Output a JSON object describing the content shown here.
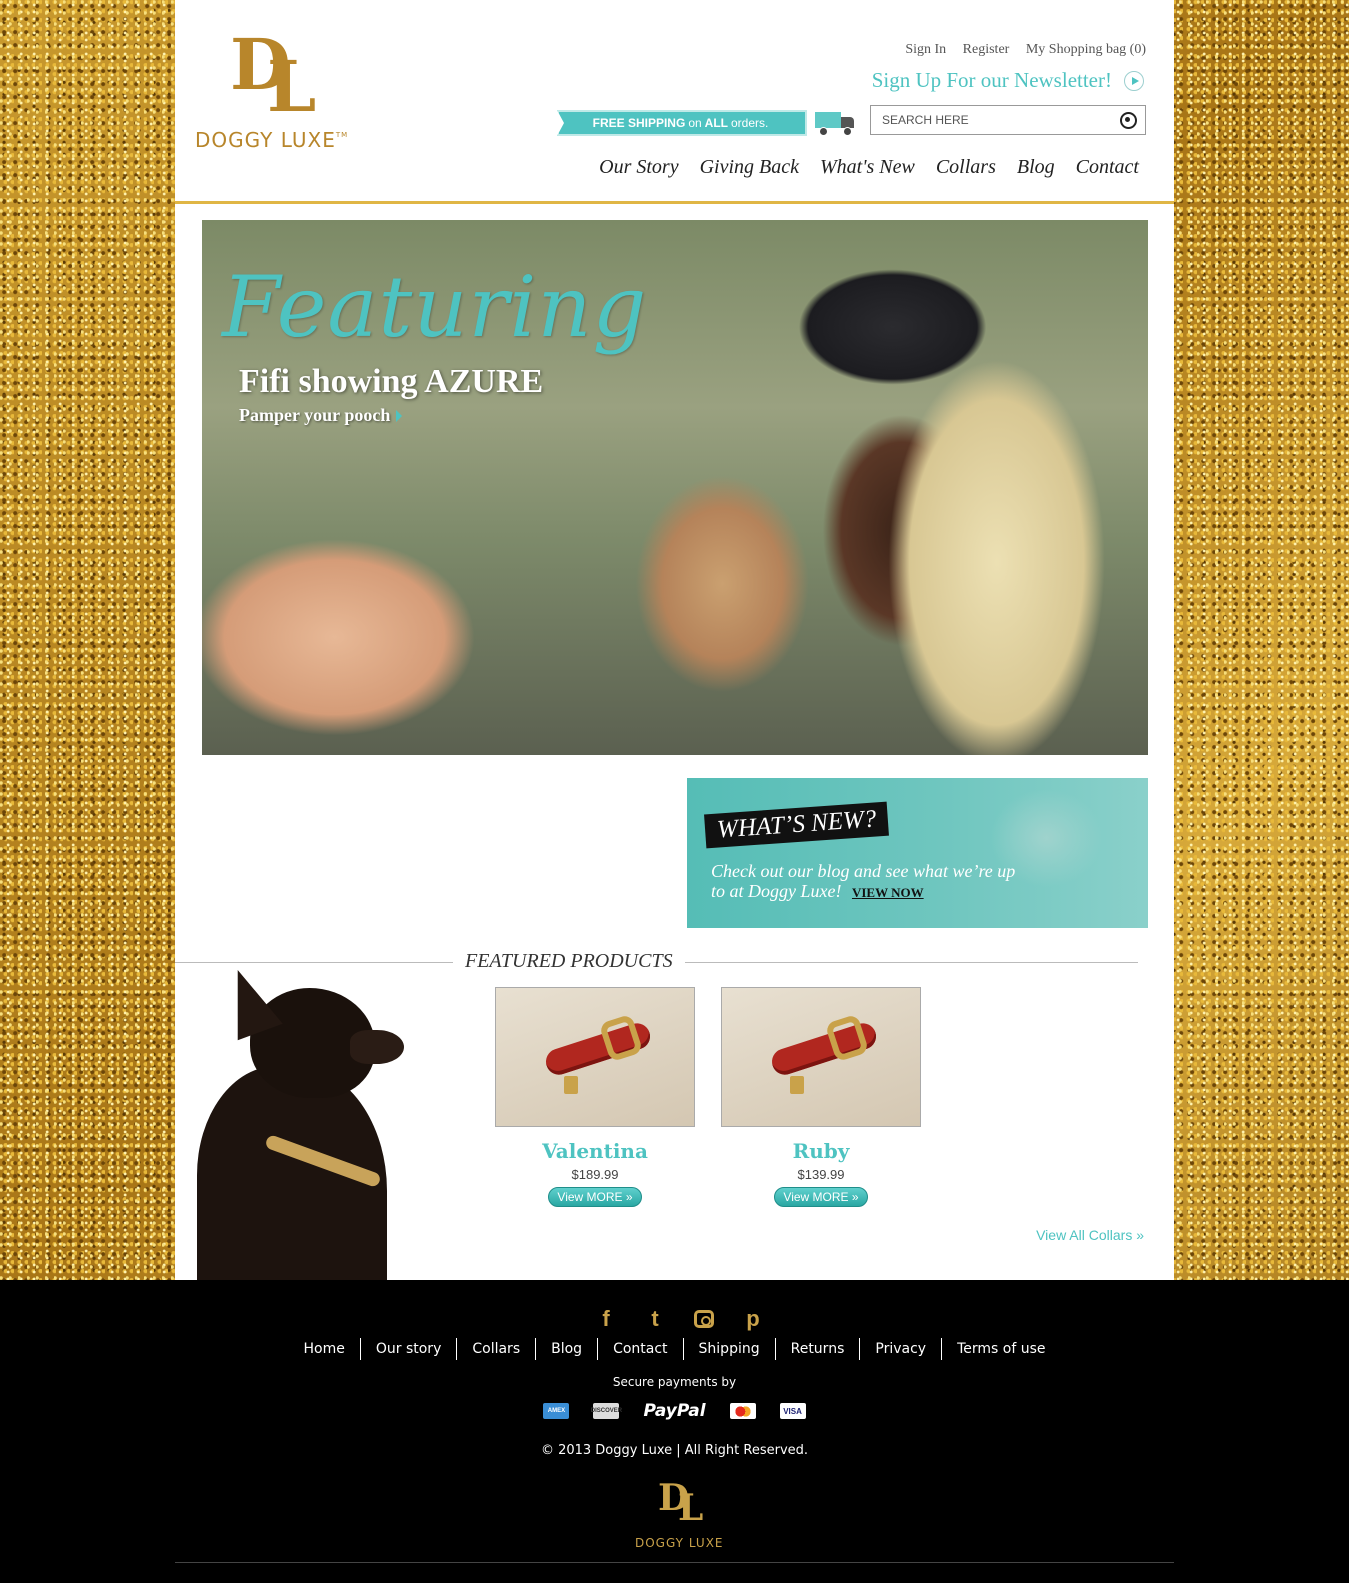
{
  "brand": {
    "monogram_d": "D",
    "monogram_l": "L",
    "name": "DOGGY LUXE",
    "tm": "TM",
    "accent_color": "#4ec3c1",
    "gold_color": "#b8862b"
  },
  "header": {
    "sign_in": "Sign In",
    "register": "Register",
    "bag": "My Shopping bag (0)",
    "newsletter": "Sign Up For our Newsletter!",
    "shipping_free": "FREE SHIPPING",
    "shipping_on": "on",
    "shipping_all": "ALL",
    "shipping_orders": "orders.",
    "search_placeholder": "SEARCH HERE"
  },
  "nav": [
    "Our Story",
    "Giving Back",
    "What's New",
    "Collars",
    "Blog",
    "Contact"
  ],
  "hero": {
    "featuring": "Featuring",
    "subtitle": "Fifi showing AZURE",
    "cta": "Pamper your pooch"
  },
  "whats_new": {
    "tag": "WHAT’S NEW?",
    "copy": "Check out our blog and see what we’re up to at Doggy Luxe!",
    "cta": "VIEW NOW"
  },
  "featured": {
    "title": "FEATURED PRODUCTS",
    "products": [
      {
        "name": "Valentina",
        "price": "$189.99",
        "button": "View MORE »"
      },
      {
        "name": "Ruby",
        "price": "$139.99",
        "button": "View MORE »"
      }
    ],
    "view_all": "View All Collars »"
  },
  "footer": {
    "social_icons": [
      "facebook-icon",
      "twitter-icon",
      "instagram-icon",
      "pinterest-icon"
    ],
    "social": {
      "facebook": "f",
      "twitter": "t",
      "pinterest": "p"
    },
    "links": [
      "Home",
      "Our story",
      "Collars",
      "Blog",
      "Contact",
      "Shipping",
      "Returns",
      "Privacy",
      "Terms of use"
    ],
    "secure": "Secure payments by",
    "payments": {
      "amex": "AMEX",
      "discover": "DISCOVER",
      "paypal": "PayPal",
      "visa": "VISA"
    },
    "copyright": "© 2013 Doggy Luxe | All Right Reserved.",
    "logo_text": "DOGGY LUXE"
  }
}
